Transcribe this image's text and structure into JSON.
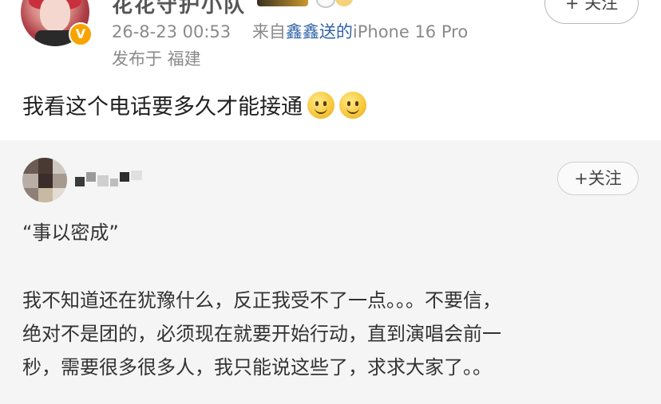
{
  "post": {
    "username": "花花守护小队",
    "verified_badge": "V",
    "timestamp": "26-8-23 00:53",
    "source_prefix": "来自",
    "source_app": "鑫鑫送的",
    "device": "iPhone 16 Pro",
    "location": "发布于 福建",
    "follow_label": "+ 关注",
    "text": "我看这个电话要多久才能接通",
    "emojis": [
      "smile-emoji",
      "smile-emoji"
    ]
  },
  "quote": {
    "follow_label": "+关注",
    "title": "“事以密成”",
    "body_lines": [
      "我不知道还在犹豫什么，反正我受不了一点。。。不要信，",
      "绝对不是团的，必须现在就要开始行动，直到演唱会前一",
      "秒，需要很多很多人，我只能说这些了，求求大家了。。"
    ]
  },
  "colors": {
    "link_blue": "#2f62a8",
    "meta_gray": "#8a8a8a",
    "quote_bg": "#f5f5f5",
    "badge_orange": "#f7a400"
  }
}
